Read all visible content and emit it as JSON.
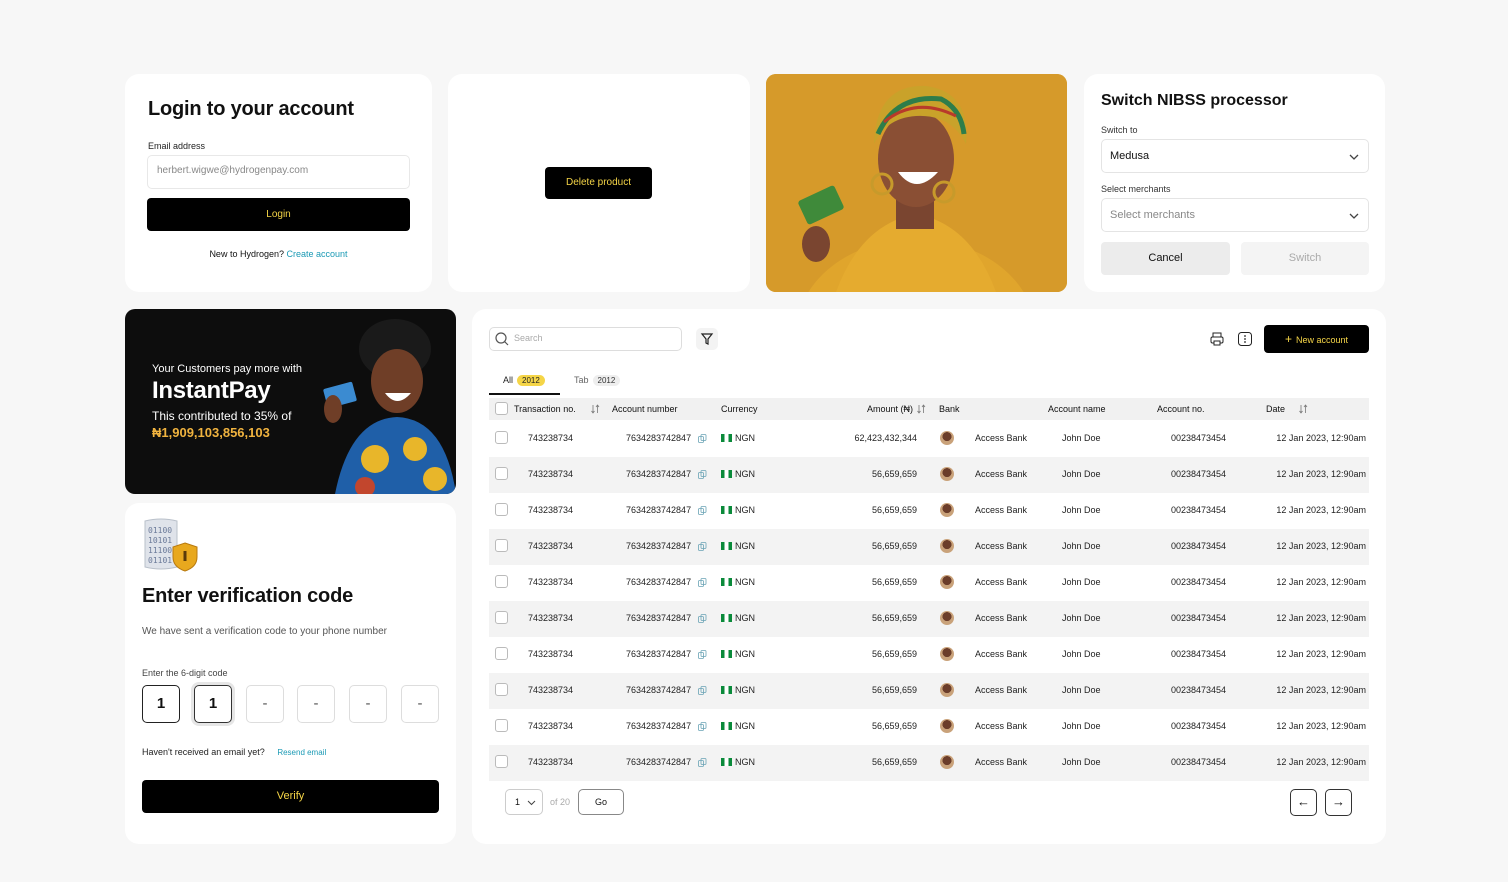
{
  "login": {
    "title": "Login to your account",
    "email_label": "Email address",
    "email_value": "herbert.wigwe@hydrogenpay.com",
    "login_label": "Login",
    "new_text": "New to Hydrogen?",
    "create_link": "Create account"
  },
  "delete_card": {
    "button_label": "Delete product"
  },
  "nibss": {
    "title": "Switch NIBSS processor",
    "switch_to_label": "Switch to",
    "switch_to_value": "Medusa",
    "merchants_label": "Select merchants",
    "merchants_placeholder": "Select merchants",
    "cancel_label": "Cancel",
    "switch_label": "Switch"
  },
  "promo": {
    "line1": "Your Customers pay more with",
    "brand": "InstantPay",
    "line3": "This contributed to 35% of",
    "amount": "₦1,909,103,856,103"
  },
  "verify": {
    "title": "Enter verification code",
    "subtitle": "We have sent a verification code to your phone number",
    "code_label": "Enter the 6-digit code",
    "digits": [
      "1",
      "1",
      "-",
      "-",
      "-",
      "-"
    ],
    "not_received": "Haven't received an email yet?",
    "resend": "Resend email",
    "verify_label": "Verify"
  },
  "table": {
    "search_placeholder": "Search",
    "new_account_label": "New account",
    "tabs": [
      {
        "label": "All",
        "count": "2012"
      },
      {
        "label": "Tab",
        "count": "2012"
      }
    ],
    "columns": [
      "Transaction no.",
      "Account number",
      "Currency",
      "Amount (₦)",
      "Bank",
      "Account name",
      "Account no.",
      "Date"
    ],
    "rows": [
      {
        "txn": "743238734",
        "acct": "7634283742847",
        "cur": "NGN",
        "amount": "62,423,432,344",
        "bank": "Access Bank",
        "name": "John Doe",
        "acctno": "00238473454",
        "date": "12 Jan 2023, 12:90am"
      },
      {
        "txn": "743238734",
        "acct": "7634283742847",
        "cur": "NGN",
        "amount": "56,659,659",
        "bank": "Access Bank",
        "name": "John Doe",
        "acctno": "00238473454",
        "date": "12 Jan 2023, 12:90am"
      },
      {
        "txn": "743238734",
        "acct": "7634283742847",
        "cur": "NGN",
        "amount": "56,659,659",
        "bank": "Access Bank",
        "name": "John Doe",
        "acctno": "00238473454",
        "date": "12 Jan 2023, 12:90am"
      },
      {
        "txn": "743238734",
        "acct": "7634283742847",
        "cur": "NGN",
        "amount": "56,659,659",
        "bank": "Access Bank",
        "name": "John Doe",
        "acctno": "00238473454",
        "date": "12 Jan 2023, 12:90am"
      },
      {
        "txn": "743238734",
        "acct": "7634283742847",
        "cur": "NGN",
        "amount": "56,659,659",
        "bank": "Access Bank",
        "name": "John Doe",
        "acctno": "00238473454",
        "date": "12 Jan 2023, 12:90am"
      },
      {
        "txn": "743238734",
        "acct": "7634283742847",
        "cur": "NGN",
        "amount": "56,659,659",
        "bank": "Access Bank",
        "name": "John Doe",
        "acctno": "00238473454",
        "date": "12 Jan 2023, 12:90am"
      },
      {
        "txn": "743238734",
        "acct": "7634283742847",
        "cur": "NGN",
        "amount": "56,659,659",
        "bank": "Access Bank",
        "name": "John Doe",
        "acctno": "00238473454",
        "date": "12 Jan 2023, 12:90am"
      },
      {
        "txn": "743238734",
        "acct": "7634283742847",
        "cur": "NGN",
        "amount": "56,659,659",
        "bank": "Access Bank",
        "name": "John Doe",
        "acctno": "00238473454",
        "date": "12 Jan 2023, 12:90am"
      },
      {
        "txn": "743238734",
        "acct": "7634283742847",
        "cur": "NGN",
        "amount": "56,659,659",
        "bank": "Access Bank",
        "name": "John Doe",
        "acctno": "00238473454",
        "date": "12 Jan 2023, 12:90am"
      },
      {
        "txn": "743238734",
        "acct": "7634283742847",
        "cur": "NGN",
        "amount": "56,659,659",
        "bank": "Access Bank",
        "name": "John Doe",
        "acctno": "00238473454",
        "date": "12 Jan 2023, 12:90am"
      }
    ],
    "pagination": {
      "page": "1",
      "of_text": "of 20",
      "go_label": "Go"
    }
  },
  "colors": {
    "accent_yellow": "#f5d547",
    "link": "#1b9ab5",
    "amount_orange": "#f0b33f"
  }
}
